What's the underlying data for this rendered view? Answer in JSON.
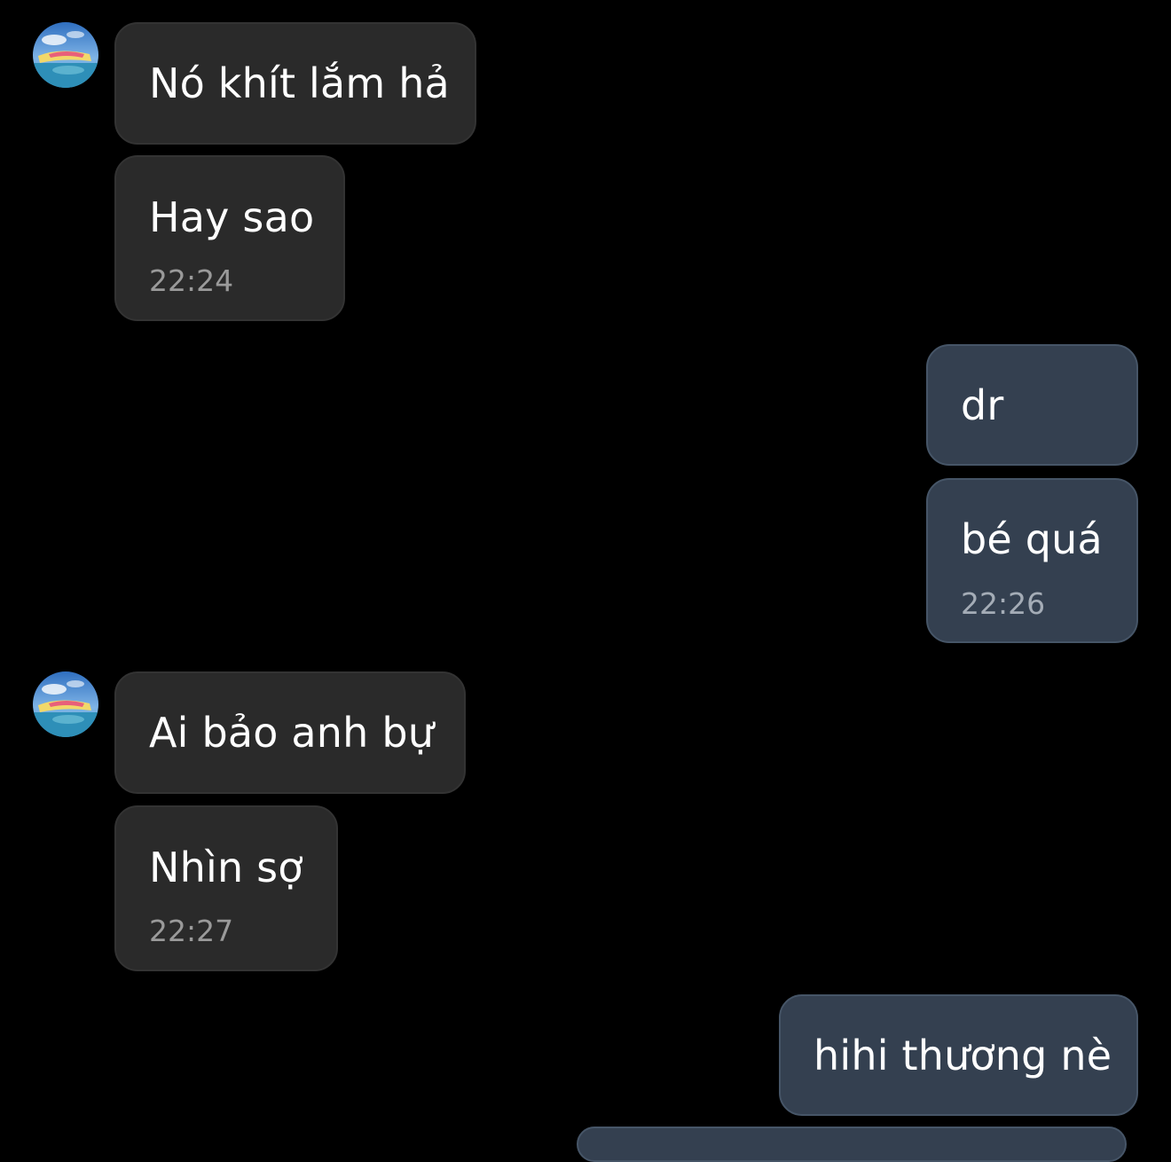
{
  "conversation": {
    "messages": [
      {
        "direction": "incoming",
        "text": "Nó khít lắm hả",
        "time": ""
      },
      {
        "direction": "incoming",
        "text": "Hay sao",
        "time": "22:24"
      },
      {
        "direction": "outgoing",
        "text": "dr",
        "time": ""
      },
      {
        "direction": "outgoing",
        "text": "bé quá",
        "time": "22:26"
      },
      {
        "direction": "incoming",
        "text": "Ai bảo anh bự",
        "time": ""
      },
      {
        "direction": "incoming",
        "text": "Nhìn sợ",
        "time": "22:27"
      },
      {
        "direction": "outgoing",
        "text": "hihi thương nè",
        "time": ""
      }
    ]
  },
  "colors": {
    "background": "#000000",
    "incoming_bubble": "#2a2a2a",
    "outgoing_bubble": "#344050",
    "text": "#ffffff",
    "timestamp": "#9a9a9a"
  },
  "icons": {
    "contact_avatar": "avatar-landscape-photo"
  }
}
